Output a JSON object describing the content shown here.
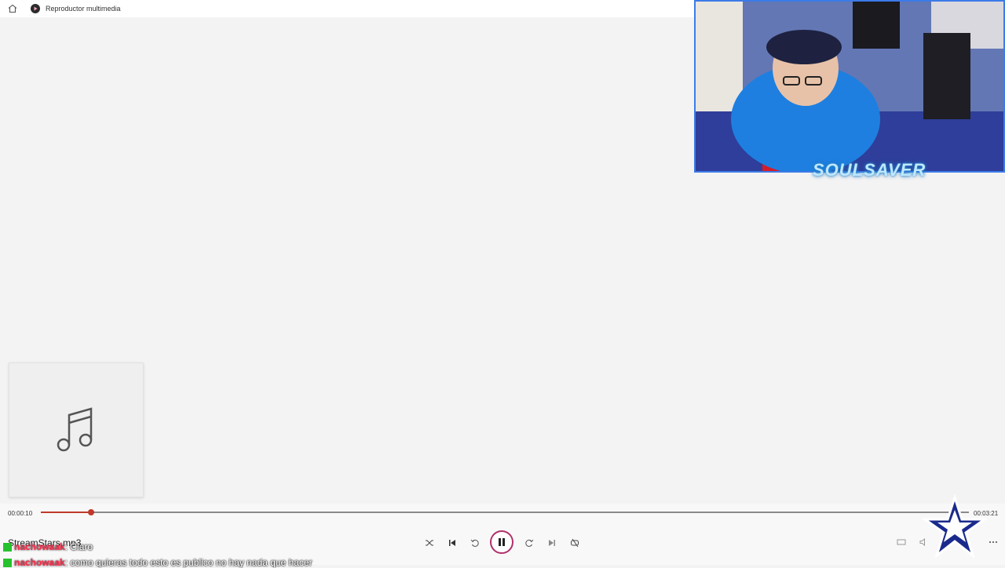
{
  "window": {
    "title": "Reproductor multimedia",
    "home_icon": "home-icon",
    "app_icon": "media-player-icon"
  },
  "player": {
    "elapsed": "00:00:10",
    "total": "00:03:21",
    "progress_fraction": 0.054,
    "track_name": "StreamStars.mp3",
    "album_art_icon": "music-note-icon",
    "accent_color": "#c0392b",
    "controls": {
      "shuffle": "shuffle-icon",
      "previous": "previous-icon",
      "rewind": "rewind-10-icon",
      "play_pause": "pause-icon",
      "forward": "forward-30-icon",
      "next": "next-icon",
      "repeat": "repeat-icon"
    }
  },
  "overlay": {
    "webcam_logo": "SOULSAVER",
    "chat": [
      {
        "user": "nachowaak",
        "message": ": Claro"
      },
      {
        "user": "nachowaak",
        "message": ": como quieras todo esto es publico no hay nada que hacer"
      }
    ]
  }
}
